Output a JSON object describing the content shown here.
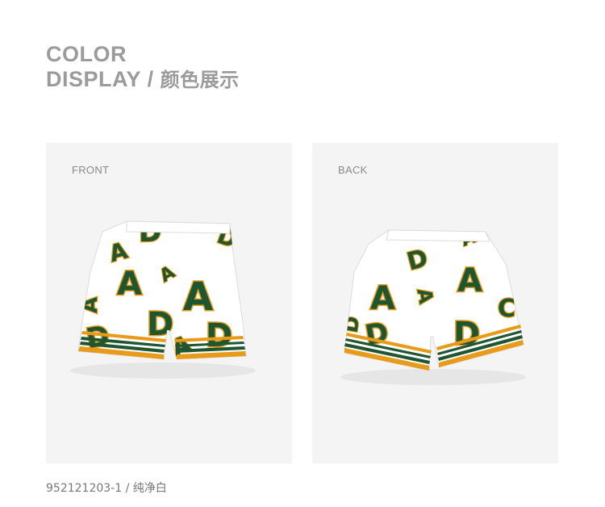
{
  "heading": {
    "line1": "COLOR",
    "line2_en": "DISPLAY",
    "separator": "/",
    "line2_cn": "颜色展示"
  },
  "panels": [
    {
      "label": "FRONT",
      "image": "shorts-front"
    },
    {
      "label": "BACK",
      "image": "shorts-back"
    }
  ],
  "caption": "952121203-1 / 纯净白",
  "colors": {
    "shorts_base": "#ffffff",
    "letter_green": "#1f5632",
    "letter_outline": "#e89b1a",
    "panel_bg": "#f4f4f4",
    "text_gray": "#9b9b9b"
  }
}
